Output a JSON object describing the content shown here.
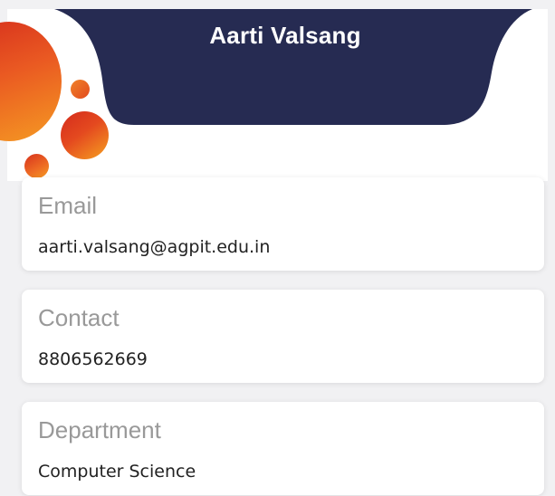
{
  "profile": {
    "name": "Aarti Valsang"
  },
  "fields": [
    {
      "label": "Email",
      "value": "aarti.valsang@agpit.edu.in"
    },
    {
      "label": "Contact",
      "value": "8806562669"
    },
    {
      "label": "Department",
      "value": "Computer Science"
    }
  ],
  "colors": {
    "header_bg": "#262b52",
    "accent_orange": "#f59a23",
    "accent_red": "#d62f1d",
    "label_text": "#999999",
    "value_text": "#222222"
  }
}
